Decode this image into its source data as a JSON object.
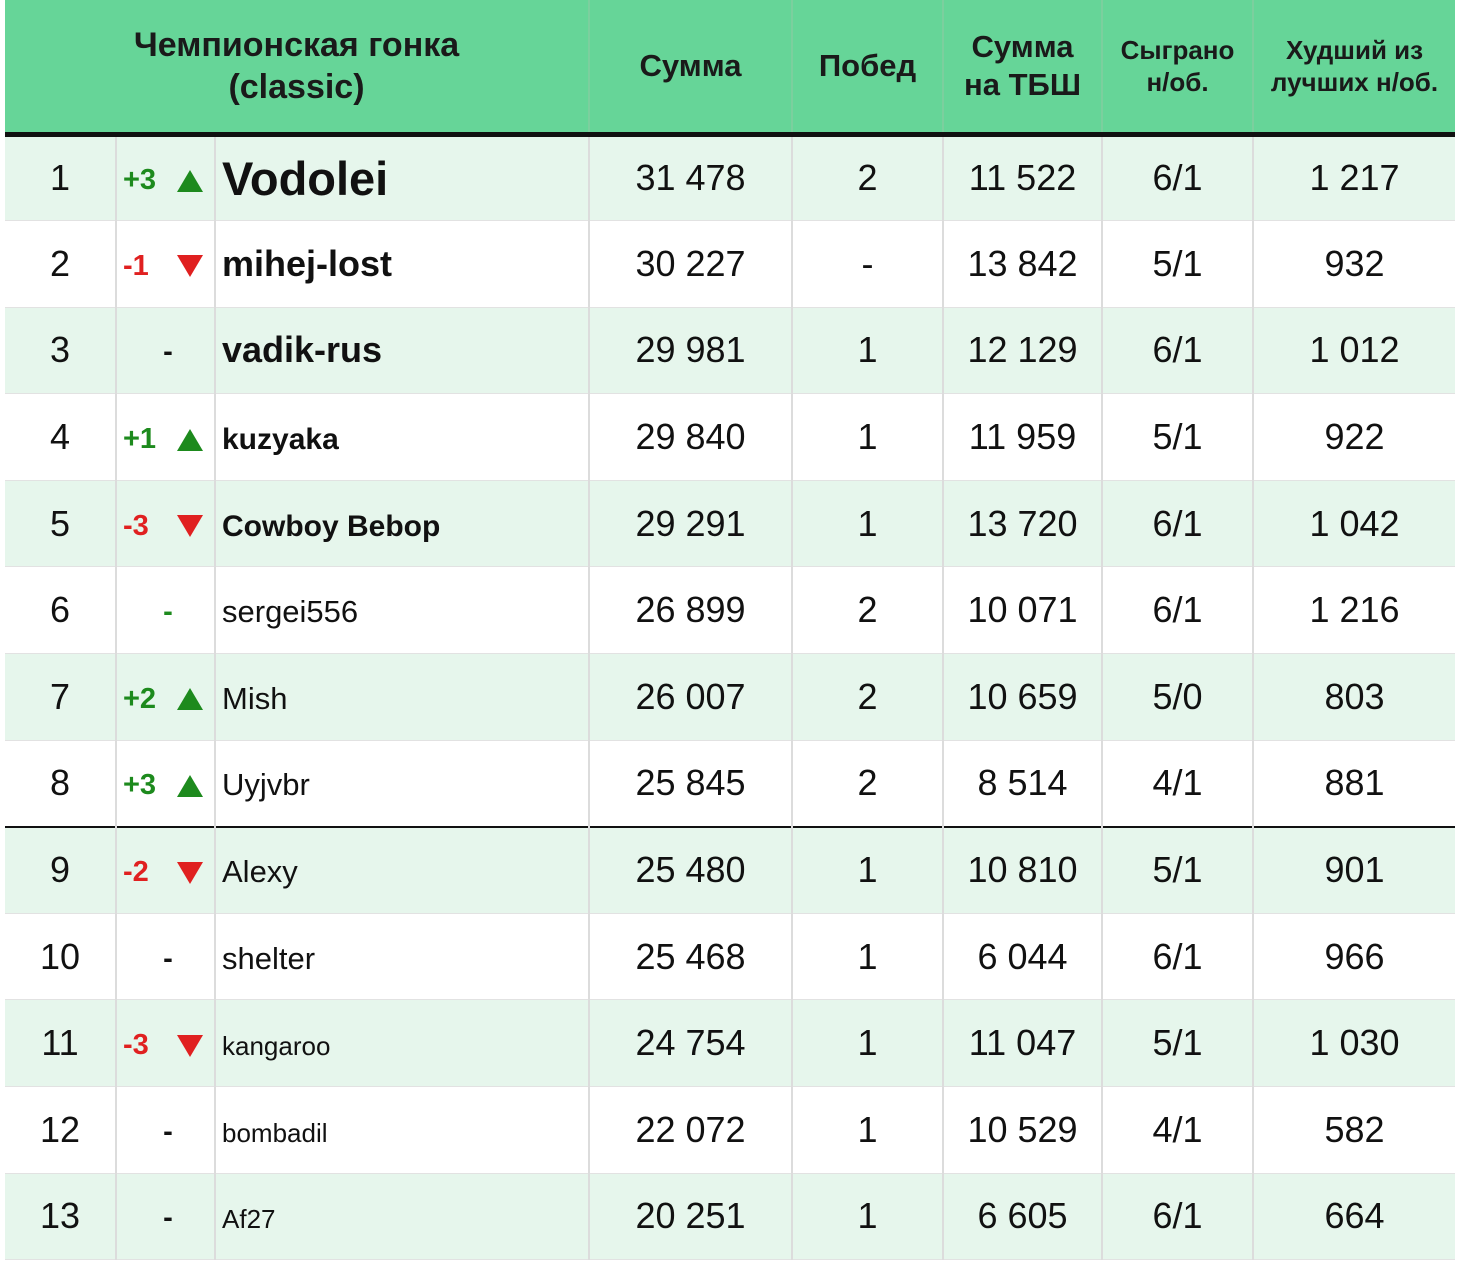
{
  "header": {
    "title_line1": "Чемпионская гонка",
    "title_line2": "(classic)",
    "sum": "Сумма",
    "wins": "Побед",
    "tbsh_line1": "Сумма",
    "tbsh_line2": "на ТБШ",
    "played_line1": "Сыграно",
    "played_line2": "н/об.",
    "worst_line1": "Худший из",
    "worst_line2": "лучших н/об."
  },
  "colors": {
    "header_bg": "#66d598",
    "row_tint": "#e6f6ec",
    "up": "#1d8a1d",
    "down": "#e02020"
  },
  "rows": [
    {
      "rank": "1",
      "change": "+3",
      "dir": "up",
      "name": "Vodolei",
      "sum": "31 478",
      "wins": "2",
      "tbsh": "11 522",
      "played": "6/1",
      "worst": "1 217"
    },
    {
      "rank": "2",
      "change": "-1",
      "dir": "down",
      "name": "mihej-lost",
      "sum": "30 227",
      "wins": "-",
      "tbsh": "13 842",
      "played": "5/1",
      "worst": "932"
    },
    {
      "rank": "3",
      "change": "-",
      "dir": "none",
      "name": "vadik-rus",
      "sum": "29 981",
      "wins": "1",
      "tbsh": "12 129",
      "played": "6/1",
      "worst": "1 012"
    },
    {
      "rank": "4",
      "change": "+1",
      "dir": "up",
      "name": "kuzyaka",
      "sum": "29 840",
      "wins": "1",
      "tbsh": "11 959",
      "played": "5/1",
      "worst": "922"
    },
    {
      "rank": "5",
      "change": "-3",
      "dir": "down",
      "name": "Cowboy Bebop",
      "sum": "29 291",
      "wins": "1",
      "tbsh": "13 720",
      "played": "6/1",
      "worst": "1 042"
    },
    {
      "rank": "6",
      "change": "-",
      "dir": "none-green",
      "name": "sergei556",
      "sum": "26 899",
      "wins": "2",
      "tbsh": "10 071",
      "played": "6/1",
      "worst": "1 216"
    },
    {
      "rank": "7",
      "change": "+2",
      "dir": "up",
      "name": "Mish",
      "sum": "26 007",
      "wins": "2",
      "tbsh": "10 659",
      "played": "5/0",
      "worst": "803"
    },
    {
      "rank": "8",
      "change": "+3",
      "dir": "up",
      "name": "Uyjvbr",
      "sum": "25 845",
      "wins": "2",
      "tbsh": "8 514",
      "played": "4/1",
      "worst": "881"
    },
    {
      "rank": "9",
      "change": "-2",
      "dir": "down",
      "name": "Alexy",
      "sum": "25 480",
      "wins": "1",
      "tbsh": "10 810",
      "played": "5/1",
      "worst": "901"
    },
    {
      "rank": "10",
      "change": "-",
      "dir": "none",
      "name": "shelter",
      "sum": "25 468",
      "wins": "1",
      "tbsh": "6 044",
      "played": "6/1",
      "worst": "966"
    },
    {
      "rank": "11",
      "change": "-3",
      "dir": "down",
      "name": "kangaroo",
      "sum": "24 754",
      "wins": "1",
      "tbsh": "11 047",
      "played": "5/1",
      "worst": "1 030"
    },
    {
      "rank": "12",
      "change": "-",
      "dir": "none",
      "name": "bombadil",
      "sum": "22 072",
      "wins": "1",
      "tbsh": "10 529",
      "played": "4/1",
      "worst": "582"
    },
    {
      "rank": "13",
      "change": "-",
      "dir": "none",
      "name": "Af27",
      "sum": "20 251",
      "wins": "1",
      "tbsh": "6 605",
      "played": "6/1",
      "worst": "664"
    }
  ]
}
